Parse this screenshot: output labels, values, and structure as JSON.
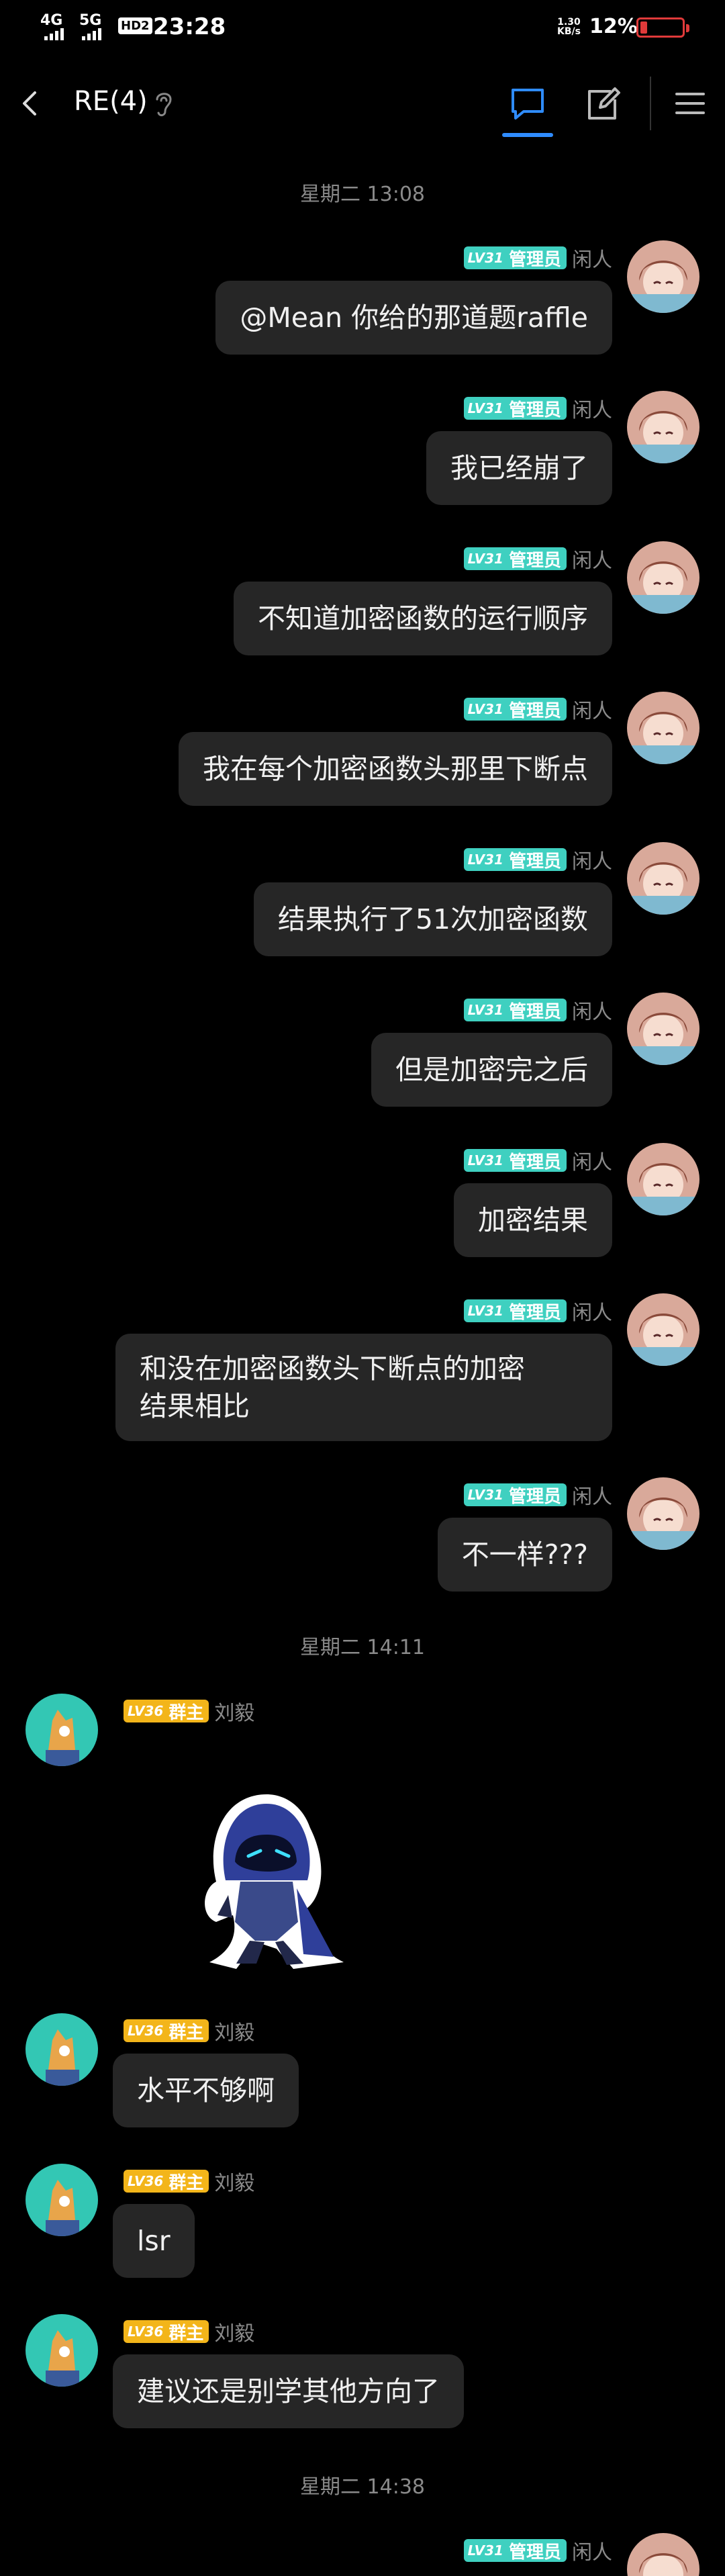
{
  "status_bar": {
    "network_1": "4G",
    "network_2": "5G",
    "hd": "HD2",
    "time": "23:28",
    "speed_value": "1.30",
    "speed_unit": "KB/s",
    "battery_text": "12%",
    "battery_level": 0.12,
    "battery_color": "#e03a3a"
  },
  "header": {
    "title": "RE(4)",
    "back_icon": "chevron-left-icon",
    "ear_icon": "ear-icon",
    "tabs": [
      "chat-bubble-icon",
      "edit-icon"
    ],
    "menu_icon": "menu-icon",
    "accent": "#2f8cff"
  },
  "timestamps": [
    "星期二 13:08",
    "星期二 14:11",
    "星期二 14:38"
  ],
  "badges": {
    "admin": {
      "level": "LV31",
      "role": "管理员",
      "color": "#3fd0c0"
    },
    "owner": {
      "level": "LV36",
      "role": "群主",
      "color": "#f3b51a"
    }
  },
  "users": {
    "me": "闲人",
    "other": "刘毅"
  },
  "messages": [
    {
      "text": "@Mean 你给的那道题raffle"
    },
    {
      "text": "我已经崩了"
    },
    {
      "text": "不知道加密函数的运行顺序"
    },
    {
      "text": "我在每个加密函数头那里下断点"
    },
    {
      "text": "结果执行了51次加密函数"
    },
    {
      "text": "但是加密完之后"
    },
    {
      "text": "加密结果"
    },
    {
      "line1": "和没在加密函数头下断点的加密",
      "line2": "结果相比"
    },
    {
      "text": "不一样???"
    },
    {
      "sticker": "hooded-ninja-sticker"
    },
    {
      "text": "水平不够啊"
    },
    {
      "text": "lsr"
    },
    {
      "text": "建议还是别学其他方向了"
    },
    {
      "text": ""
    }
  ]
}
